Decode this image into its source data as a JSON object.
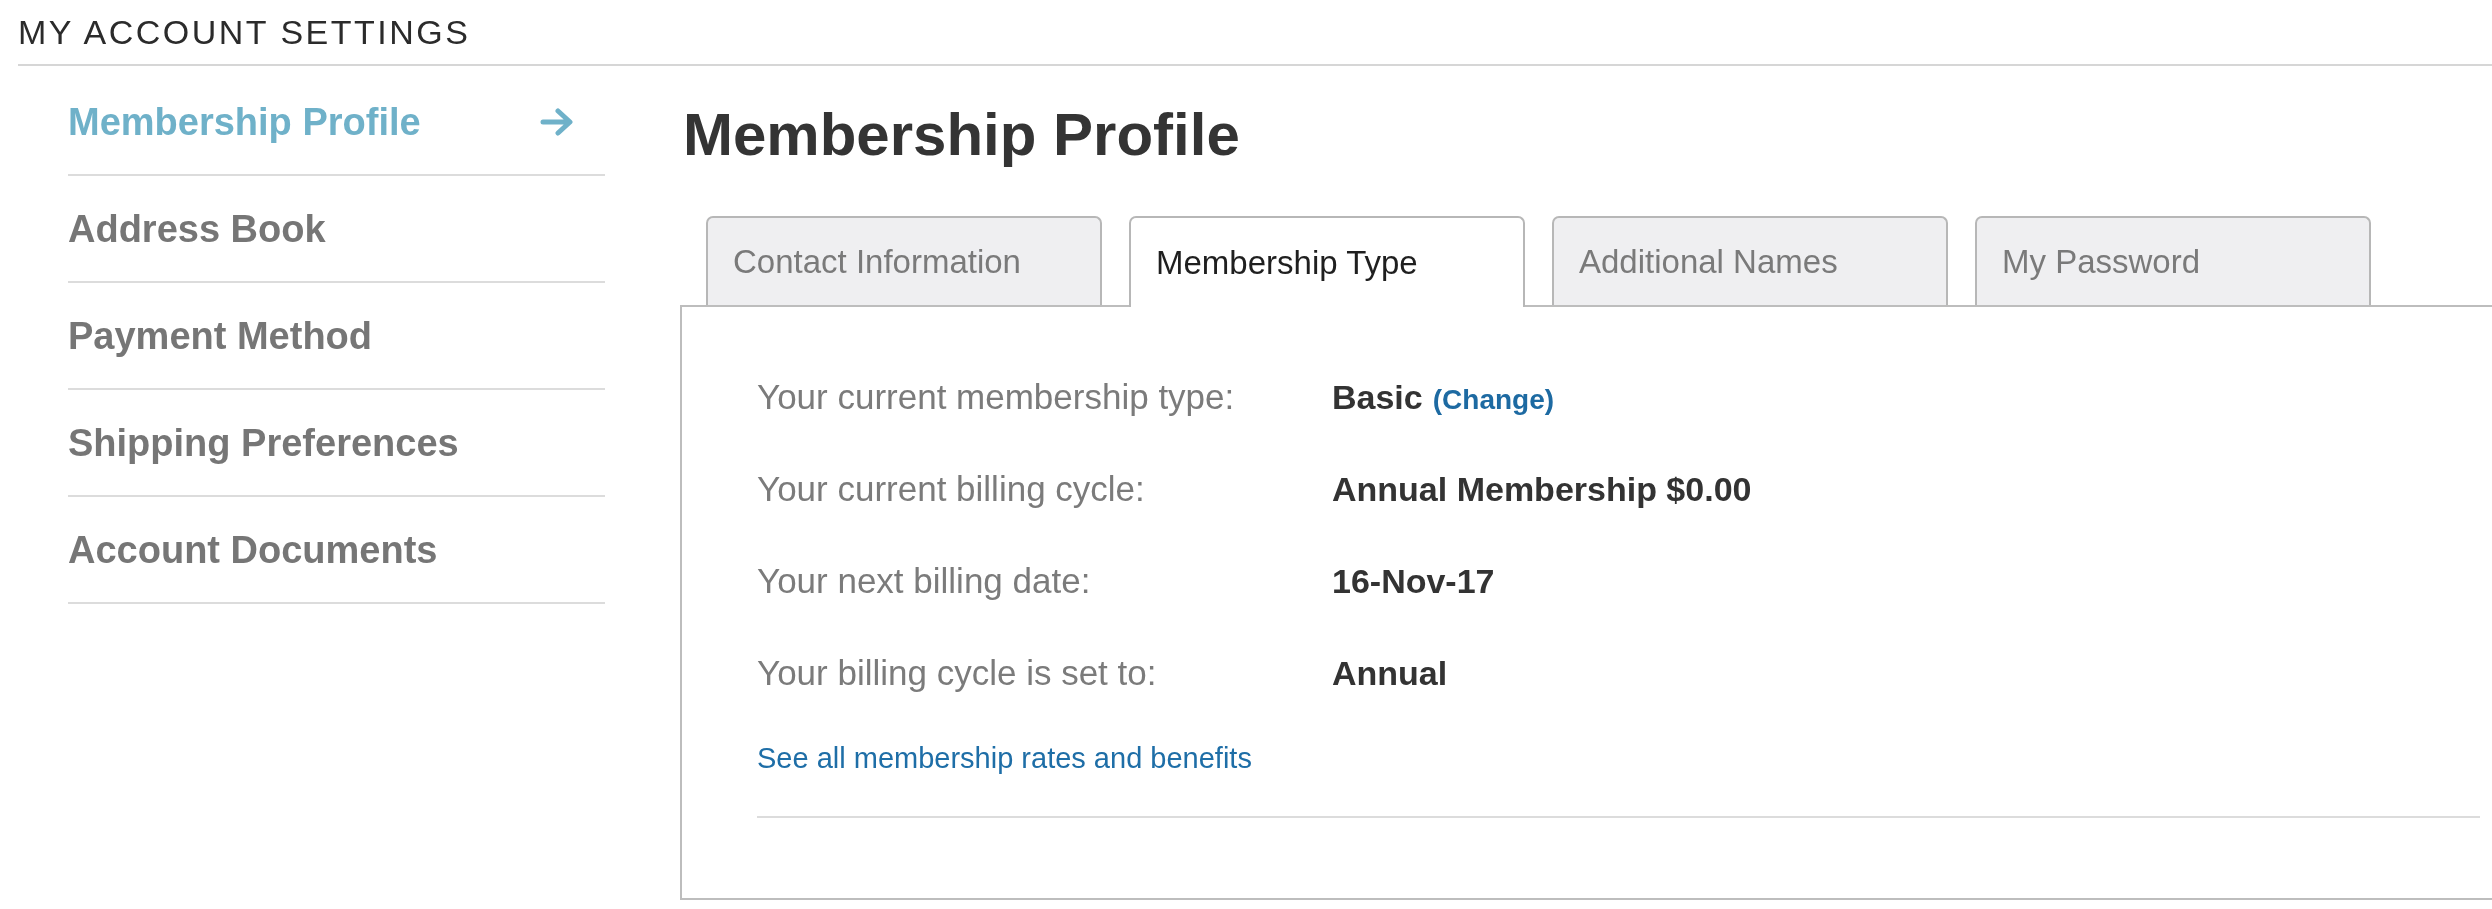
{
  "page_title": "MY ACCOUNT SETTINGS",
  "sidebar": {
    "items": [
      {
        "label": "Membership Profile",
        "selected": true
      },
      {
        "label": "Address Book",
        "selected": false
      },
      {
        "label": "Payment Method",
        "selected": false
      },
      {
        "label": "Shipping Preferences",
        "selected": false
      },
      {
        "label": "Account Documents",
        "selected": false
      }
    ]
  },
  "heading": "Membership Profile",
  "tabs": [
    {
      "label": "Contact Information",
      "selected": false
    },
    {
      "label": "Membership Type",
      "selected": true
    },
    {
      "label": "Additional Names",
      "selected": false
    },
    {
      "label": "My Password",
      "selected": false
    }
  ],
  "membership_details": {
    "rows": [
      {
        "label": "Your current membership type:",
        "value": "Basic",
        "link": "(Change)"
      },
      {
        "label": "Your current billing cycle:",
        "value": "Annual Membership $0.00"
      },
      {
        "label": "Your next billing date:",
        "value": "16-Nov-17"
      },
      {
        "label": "Your billing cycle is set to:",
        "value": "Annual"
      }
    ],
    "footer_link": "See all membership rates and benefits"
  }
}
